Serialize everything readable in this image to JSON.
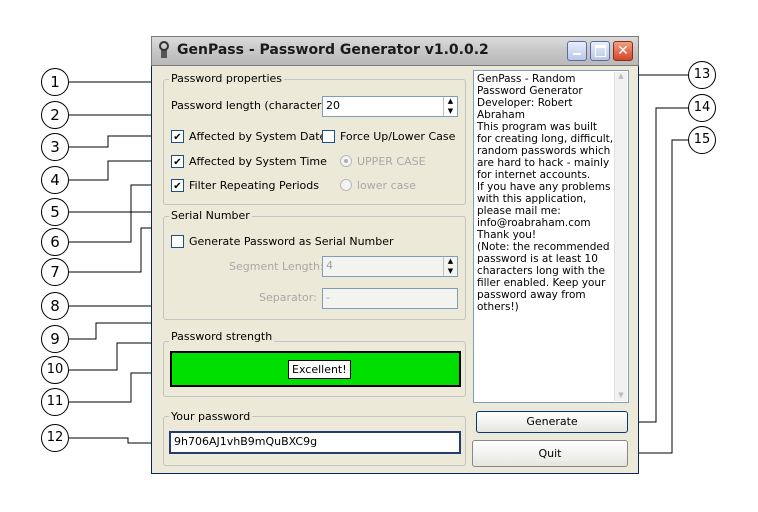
{
  "window": {
    "title": "GenPass - Password Generator v1.0.0.2",
    "buttons": {
      "minimize": "minimize-icon",
      "maximize": "maximize-icon",
      "close": "close-icon"
    }
  },
  "password_properties": {
    "group_label": "Password properties",
    "length_label": "Password length (characters):",
    "length_value": "20",
    "affected_by_date": {
      "label": "Affected by System Date",
      "checked": true
    },
    "affected_by_time": {
      "label": "Affected by System Time",
      "checked": true
    },
    "filter_repeating": {
      "label": "Filter Repeating Periods",
      "checked": true
    },
    "force_case": {
      "label": "Force Up/Lower Case",
      "checked": false
    },
    "upper_case": {
      "label": "UPPER CASE",
      "selected": true,
      "enabled": false
    },
    "lower_case": {
      "label": "lower case",
      "selected": false,
      "enabled": false
    }
  },
  "serial_number": {
    "group_label": "Serial Number",
    "generate_as_serial": {
      "label": "Generate Password as Serial Number",
      "checked": false
    },
    "segment_length_label": "Segment Length:",
    "segment_length_value": "4",
    "separator_label": "Separator:",
    "separator_value": "-"
  },
  "password_strength": {
    "group_label": "Password strength",
    "value_label": "Excellent!",
    "bar_color": "#00e000"
  },
  "your_password": {
    "group_label": "Your password",
    "value": "9h706AJ1vhB9mQuBXC9g"
  },
  "info_text": [
    "GenPass - Random Password Generator",
    "",
    "Developer: Robert Abraham",
    "This program was built for creating long, difficult, random passwords which are hard to hack - mainly for internet accounts.",
    "If you have any problems with this application, please mail me:",
    "info@roabraham.com",
    "",
    "Thank you!",
    "",
    "(Note: the recommended password is at least 10 characters long with the filler enabled. Keep your password away from others!)"
  ],
  "actions": {
    "generate": "Generate",
    "quit": "Quit"
  },
  "callouts": [
    "1",
    "2",
    "3",
    "4",
    "5",
    "6",
    "7",
    "8",
    "9",
    "10",
    "11",
    "12",
    "13",
    "14",
    "15"
  ]
}
